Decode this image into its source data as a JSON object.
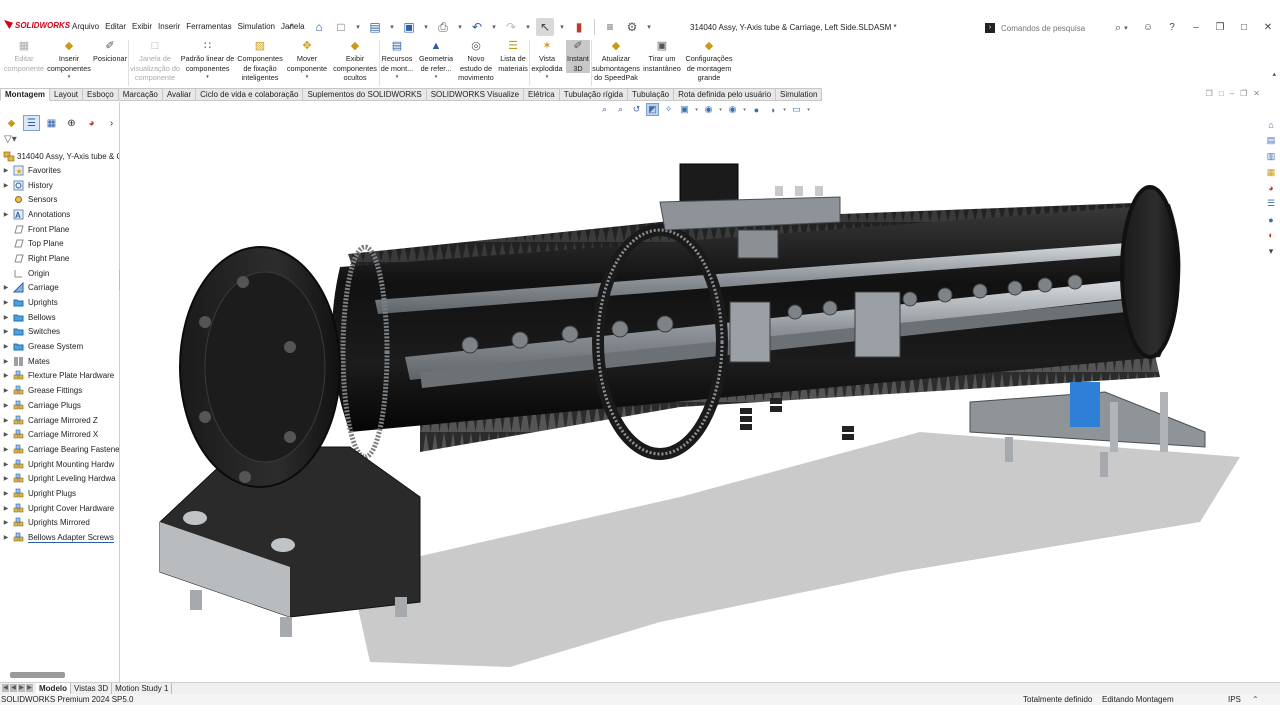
{
  "app": {
    "logo": "SOLIDWORKS",
    "document_title": "314040 Assy, Y-Axis tube & Carriage, Left Side.SLDASM *"
  },
  "menu": [
    "Arquivo",
    "Editar",
    "Exibir",
    "Inserir",
    "Ferramentas",
    "Simulation",
    "Janela"
  ],
  "search": {
    "placeholder": "Comandos de pesquisa"
  },
  "command_manager": [
    {
      "label": "Editar componente",
      "lines": [
        "Editar",
        "componente"
      ],
      "icon": "edit-component-icon",
      "enabled": false
    },
    {
      "label": "Inserir componentes",
      "lines": [
        "Inserir",
        "componentes"
      ],
      "icon": "insert-components-icon",
      "enabled": true
    },
    {
      "label": "Posicionar",
      "lines": [
        "Posicionar"
      ],
      "icon": "mate-icon",
      "enabled": true
    },
    {
      "label": "Janela de visualização do componente",
      "lines": [
        "Janela de",
        "visualização do",
        "componente"
      ],
      "icon": "component-preview-icon",
      "enabled": false
    },
    {
      "label": "Padrão linear de componentes",
      "lines": [
        "Padrão linear de",
        "componentes"
      ],
      "icon": "linear-pattern-icon",
      "enabled": true
    },
    {
      "label": "Componentes de fixação inteligentes",
      "lines": [
        "Componentes",
        "de fixação",
        "inteligentes"
      ],
      "icon": "smart-fasteners-icon",
      "enabled": true
    },
    {
      "label": "Mover componente",
      "lines": [
        "Mover",
        "componente"
      ],
      "icon": "move-component-icon",
      "enabled": true
    },
    {
      "label": "Exibir componentes ocultos",
      "lines": [
        "Exibir",
        "componentes",
        "ocultos"
      ],
      "icon": "show-hidden-icon",
      "enabled": true
    },
    {
      "label": "Recursos de mont...",
      "lines": [
        "Recursos",
        "de mont..."
      ],
      "icon": "assembly-features-icon",
      "enabled": true
    },
    {
      "label": "Geometria de refer...",
      "lines": [
        "Geometria",
        "de refer..."
      ],
      "icon": "reference-geometry-icon",
      "enabled": true
    },
    {
      "label": "Novo estudo de movimento",
      "lines": [
        "Novo",
        "estudo de",
        "movimento"
      ],
      "icon": "motion-study-icon",
      "enabled": true
    },
    {
      "label": "Lista de materiais",
      "lines": [
        "Lista de",
        "materiais"
      ],
      "icon": "bom-icon",
      "enabled": true
    },
    {
      "label": "Vista explodida",
      "lines": [
        "Vista",
        "explodida"
      ],
      "icon": "exploded-view-icon",
      "enabled": true
    },
    {
      "label": "Instant 3D",
      "lines": [
        "Instant",
        "3D"
      ],
      "icon": "instant3d-icon",
      "enabled": true
    },
    {
      "label": "Atualizar submontagens do SpeedPak",
      "lines": [
        "Atualizar",
        "submontagens",
        "do SpeedPak"
      ],
      "icon": "speedpak-icon",
      "enabled": true
    },
    {
      "label": "Tirar um instantâneo",
      "lines": [
        "Tirar um",
        "instantâneo"
      ],
      "icon": "snapshot-icon",
      "enabled": true
    },
    {
      "label": "Configurações de montagem grande",
      "lines": [
        "Configurações",
        "de montagem",
        "grande"
      ],
      "icon": "large-assembly-icon",
      "enabled": true
    }
  ],
  "tabs": [
    "Montagem",
    "Layout",
    "Esboço",
    "Marcação",
    "Avaliar",
    "Ciclo de vida e colaboração",
    "Suplementos do SOLIDWORKS",
    "SOLIDWORKS Visualize",
    "Elétrica",
    "Tubulação rígida",
    "Tubulação",
    "Rota definida pelo usuário",
    "Simulation"
  ],
  "active_tab": "Montagem",
  "feature_tree": {
    "root": "314040 Assy, Y-Axis tube & C",
    "items": [
      {
        "label": "Favorites",
        "icon": "favorites-icon",
        "expandable": true
      },
      {
        "label": "History",
        "icon": "history-icon",
        "expandable": true
      },
      {
        "label": "Sensors",
        "icon": "sensors-icon",
        "expandable": false
      },
      {
        "label": "Annotations",
        "icon": "annotations-icon",
        "expandable": true
      },
      {
        "label": "Front Plane",
        "icon": "plane-icon",
        "expandable": false
      },
      {
        "label": "Top Plane",
        "icon": "plane-icon",
        "expandable": false
      },
      {
        "label": "Right Plane",
        "icon": "plane-icon",
        "expandable": false
      },
      {
        "label": "Origin",
        "icon": "origin-icon",
        "expandable": false
      },
      {
        "label": "Carriage",
        "icon": "part-icon",
        "expandable": true
      },
      {
        "label": "Uprights",
        "icon": "folder-icon",
        "expandable": true
      },
      {
        "label": "Bellows",
        "icon": "folder-icon",
        "expandable": true
      },
      {
        "label": "Switches",
        "icon": "folder-icon",
        "expandable": true
      },
      {
        "label": "Grease System",
        "icon": "folder-icon",
        "expandable": true
      },
      {
        "label": "Mates",
        "icon": "mates-icon",
        "expandable": true
      },
      {
        "label": "Flexture Plate Hardware",
        "icon": "pattern-icon",
        "expandable": true
      },
      {
        "label": "Grease Fittings",
        "icon": "pattern-icon",
        "expandable": true
      },
      {
        "label": "Carriage Plugs",
        "icon": "pattern-icon",
        "expandable": true
      },
      {
        "label": "Carriage Mirrored Z",
        "icon": "pattern-icon",
        "expandable": true
      },
      {
        "label": "Carriage Mirrored X",
        "icon": "pattern-icon",
        "expandable": true
      },
      {
        "label": "Carriage Bearing Fastene",
        "icon": "pattern-icon",
        "expandable": true
      },
      {
        "label": "Upright Mounting Hardw",
        "icon": "pattern-icon",
        "expandable": true
      },
      {
        "label": "Upright Leveling Hardwa",
        "icon": "pattern-icon",
        "expandable": true
      },
      {
        "label": "Upright Plugs",
        "icon": "pattern-icon",
        "expandable": true
      },
      {
        "label": "Upright Cover Hardware",
        "icon": "pattern-icon",
        "expandable": true
      },
      {
        "label": "Uprights Mirrored",
        "icon": "pattern-icon",
        "expandable": true
      },
      {
        "label": "Bellows Adapter Screws",
        "icon": "pattern-icon",
        "expandable": true,
        "selected": true
      }
    ]
  },
  "bottom_tabs": [
    "Modelo",
    "Vistas 3D",
    "Motion Study 1"
  ],
  "active_bottom_tab": "Modelo",
  "status": {
    "version": "SOLIDWORKS Premium 2024 SP5.0",
    "definition": "Totalmente definido",
    "mode": "Editando Montagem",
    "units": "IPS"
  },
  "colors": {
    "brand_red": "#d0021b",
    "accent_blue": "#2a5fa8",
    "tube_black": "#1a1a1a",
    "steel": "#9aa0a6",
    "upright_blue": "#2e7fd6"
  }
}
